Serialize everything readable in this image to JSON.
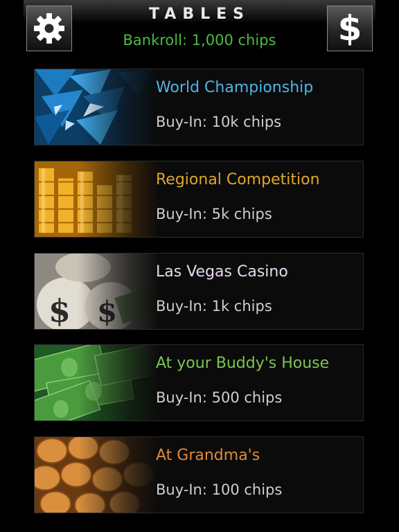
{
  "header": {
    "title": "TABLES",
    "bankroll": "Bankroll: 1,000 chips",
    "settings_icon": "gear-icon",
    "shop_icon": "dollar-icon",
    "shop_glyph": "$"
  },
  "tables": [
    {
      "name": "World Championship",
      "buy_in": "Buy-In: 10k chips",
      "color": "#4fb6e6",
      "art": "blue-crystals"
    },
    {
      "name": "Regional Competition",
      "buy_in": "Buy-In: 5k chips",
      "color": "#e0a72a",
      "art": "gold-coin-stacks"
    },
    {
      "name": "Las Vegas Casino",
      "buy_in": "Buy-In: 1k chips",
      "color": "#e9d9ef",
      "art": "money-bags"
    },
    {
      "name": "At your Buddy's House",
      "buy_in": "Buy-In: 500 chips",
      "color": "#7ac655",
      "art": "dollar-bills"
    },
    {
      "name": "At Grandma's",
      "buy_in": "Buy-In: 100 chips",
      "color": "#e08a3a",
      "art": "copper-coins"
    }
  ]
}
